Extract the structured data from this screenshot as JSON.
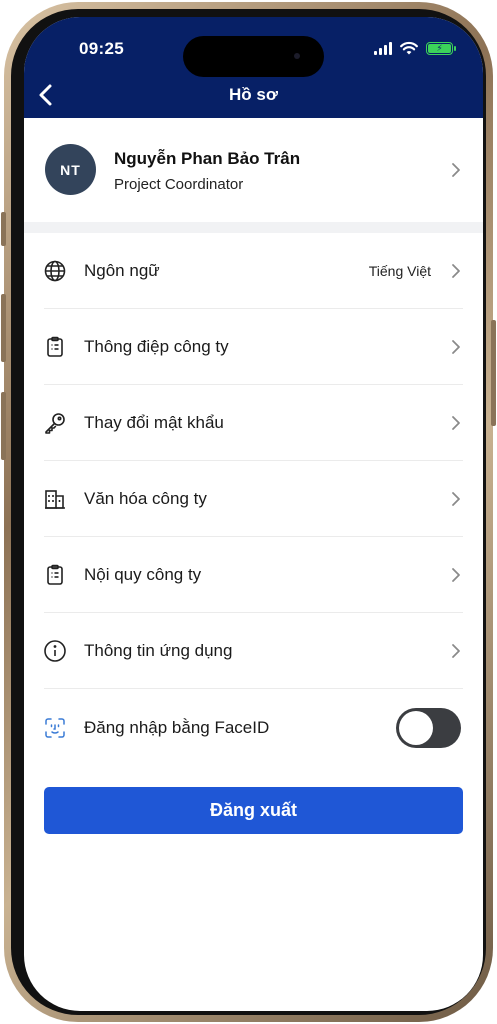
{
  "status_bar": {
    "time": "09:25"
  },
  "nav": {
    "title": "Hồ sơ"
  },
  "profile": {
    "initials": "NT",
    "name": "Nguyễn Phan Bảo Trân",
    "role": "Project Coordinator"
  },
  "menu": {
    "items": [
      {
        "label": "Ngôn ngữ",
        "value": "Tiếng Việt",
        "icon": "globe-icon"
      },
      {
        "label": "Thông điệp công ty",
        "icon": "clipboard-icon"
      },
      {
        "label": "Thay đổi mật khẩu",
        "icon": "key-icon"
      },
      {
        "label": "Văn hóa công ty",
        "icon": "building-icon"
      },
      {
        "label": "Nội quy công ty",
        "icon": "clipboard-list-icon"
      },
      {
        "label": "Thông tin ứng dụng",
        "icon": "info-icon"
      }
    ],
    "faceid": {
      "label": "Đăng nhập bằng FaceID",
      "icon": "faceid-icon",
      "enabled": false
    }
  },
  "logout": {
    "label": "Đăng xuất"
  },
  "colors": {
    "nav_bg": "#072066",
    "accent": "#1f57d6",
    "toggle_off": "#3b3d41"
  }
}
